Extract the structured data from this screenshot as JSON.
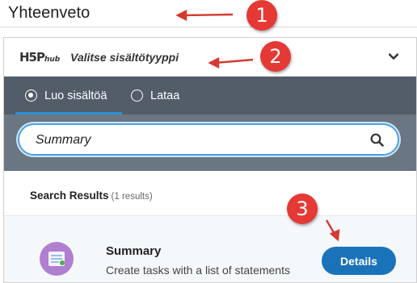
{
  "title_field": {
    "value": "Yhteenveto"
  },
  "hub": {
    "logo": {
      "mark": "H5P",
      "sub": "hub"
    },
    "title": "Valitse sisältötyyppi",
    "tabs": [
      {
        "label": "Luo sisältöä",
        "selected": true
      },
      {
        "label": "Lataa",
        "selected": false
      }
    ],
    "search": {
      "value": "Summary"
    },
    "results": {
      "label": "Search Results",
      "count": "(1 results)",
      "items": [
        {
          "title": "Summary",
          "description": "Create tasks with a list of statements",
          "icon": "summary-content-icon",
          "button": "Details"
        }
      ]
    }
  },
  "callouts": [
    "1",
    "2",
    "3"
  ],
  "colors": {
    "accent": "#2b91d9",
    "tabbar": "#525d69",
    "search_area": "#6a7682",
    "details_button": "#1a73b9",
    "callout": "#e53935",
    "content_icon": "#b07fd0"
  }
}
